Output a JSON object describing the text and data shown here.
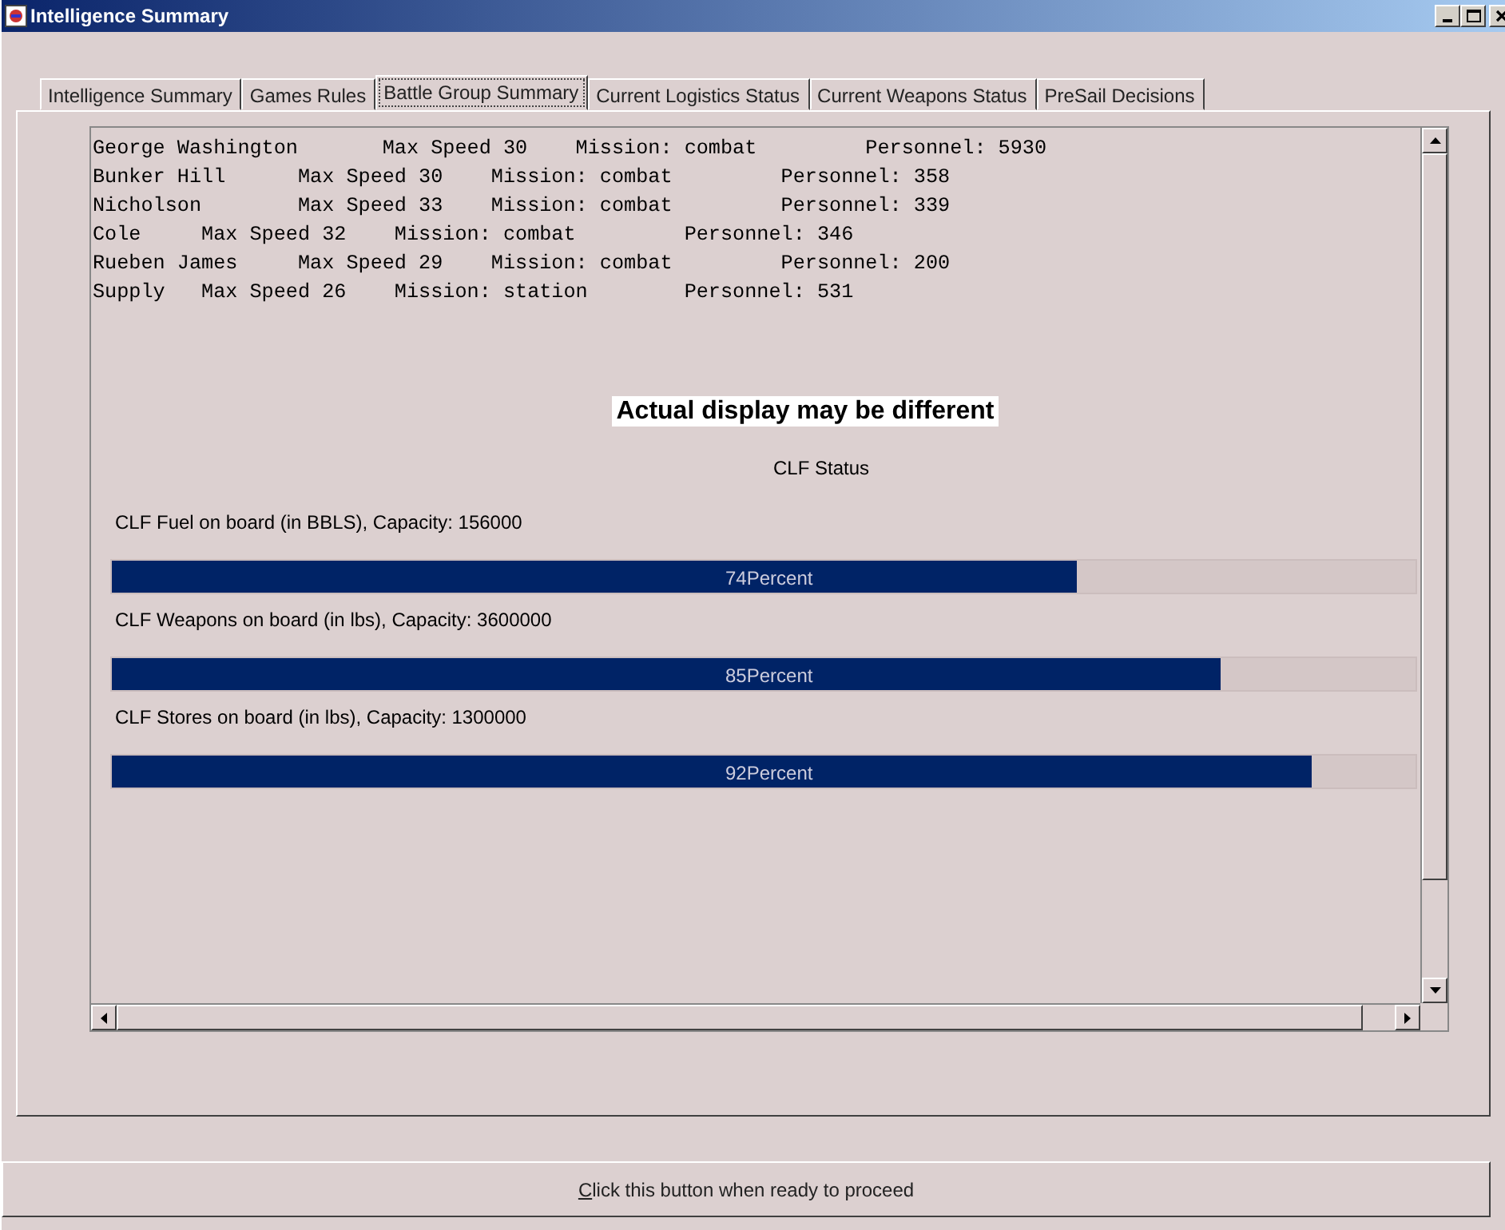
{
  "window": {
    "title": "Intelligence Summary"
  },
  "tabs": [
    {
      "label": "Intelligence Summary",
      "selected": false
    },
    {
      "label": "Games Rules",
      "selected": false
    },
    {
      "label": "Battle Group Summary",
      "selected": true
    },
    {
      "label": "Current Logistics Status",
      "selected": false
    },
    {
      "label": "Current Weapons Status",
      "selected": false
    },
    {
      "label": "PreSail Decisions",
      "selected": false
    }
  ],
  "ships": [
    "George Washington       Max Speed 30    Mission: combat         Personnel: 5930",
    "Bunker Hill      Max Speed 30    Mission: combat         Personnel: 358",
    "Nicholson        Max Speed 33    Mission: combat         Personnel: 339",
    "Cole     Max Speed 32    Mission: combat         Personnel: 346",
    "Rueben James     Max Speed 29    Mission: combat         Personnel: 200",
    "Supply   Max Speed 26    Mission: station        Personnel: 531"
  ],
  "notice": "Actual display may be different",
  "clf": {
    "title": "CLF Status",
    "items": [
      {
        "label": "CLF Fuel on board (in BBLS), Capacity: 156000",
        "level": 0.74,
        "reading": "74Percent"
      },
      {
        "label": "CLF Weapons on board (in lbs), Capacity: 3600000",
        "level": 0.85,
        "reading": "85Percent"
      },
      {
        "label": "CLF Stores on board (in lbs), Capacity: 1300000",
        "level": 0.92,
        "reading": "92Percent"
      }
    ]
  },
  "proceed_button": "Click this button when ready to proceed"
}
